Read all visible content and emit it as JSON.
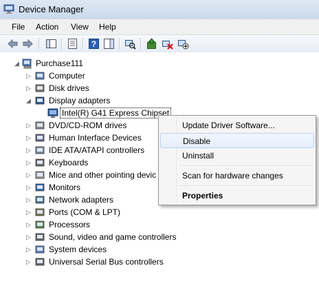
{
  "window": {
    "title": "Device Manager"
  },
  "menu": [
    "File",
    "Action",
    "View",
    "Help"
  ],
  "toolbar": {
    "buttons": [
      "back-icon",
      "forward-icon",
      "show-hide-console-tree-icon",
      "properties-icon",
      "help-icon",
      "show-hide-action-pane-icon",
      "scan-hardware-icon",
      "update-driver-icon",
      "uninstall-icon",
      "disable-icon"
    ]
  },
  "tree": {
    "root": "Purchase111",
    "categories": [
      "Computer",
      "Disk drives",
      "Display adapters",
      "DVD/CD-ROM drives",
      "Human Interface Devices",
      "IDE ATA/ATAPI controllers",
      "Keyboards",
      "Mice and other pointing devic",
      "Monitors",
      "Network adapters",
      "Ports (COM & LPT)",
      "Processors",
      "Sound, video and game controllers",
      "System devices",
      "Universal Serial Bus controllers"
    ],
    "selected_device": "Intel(R) G41 Express Chipset"
  },
  "context_menu": {
    "items": [
      "Update Driver Software...",
      "Disable",
      "Uninstall",
      "Scan for hardware changes",
      "Properties"
    ],
    "highlighted": "Disable",
    "default": "Properties"
  }
}
